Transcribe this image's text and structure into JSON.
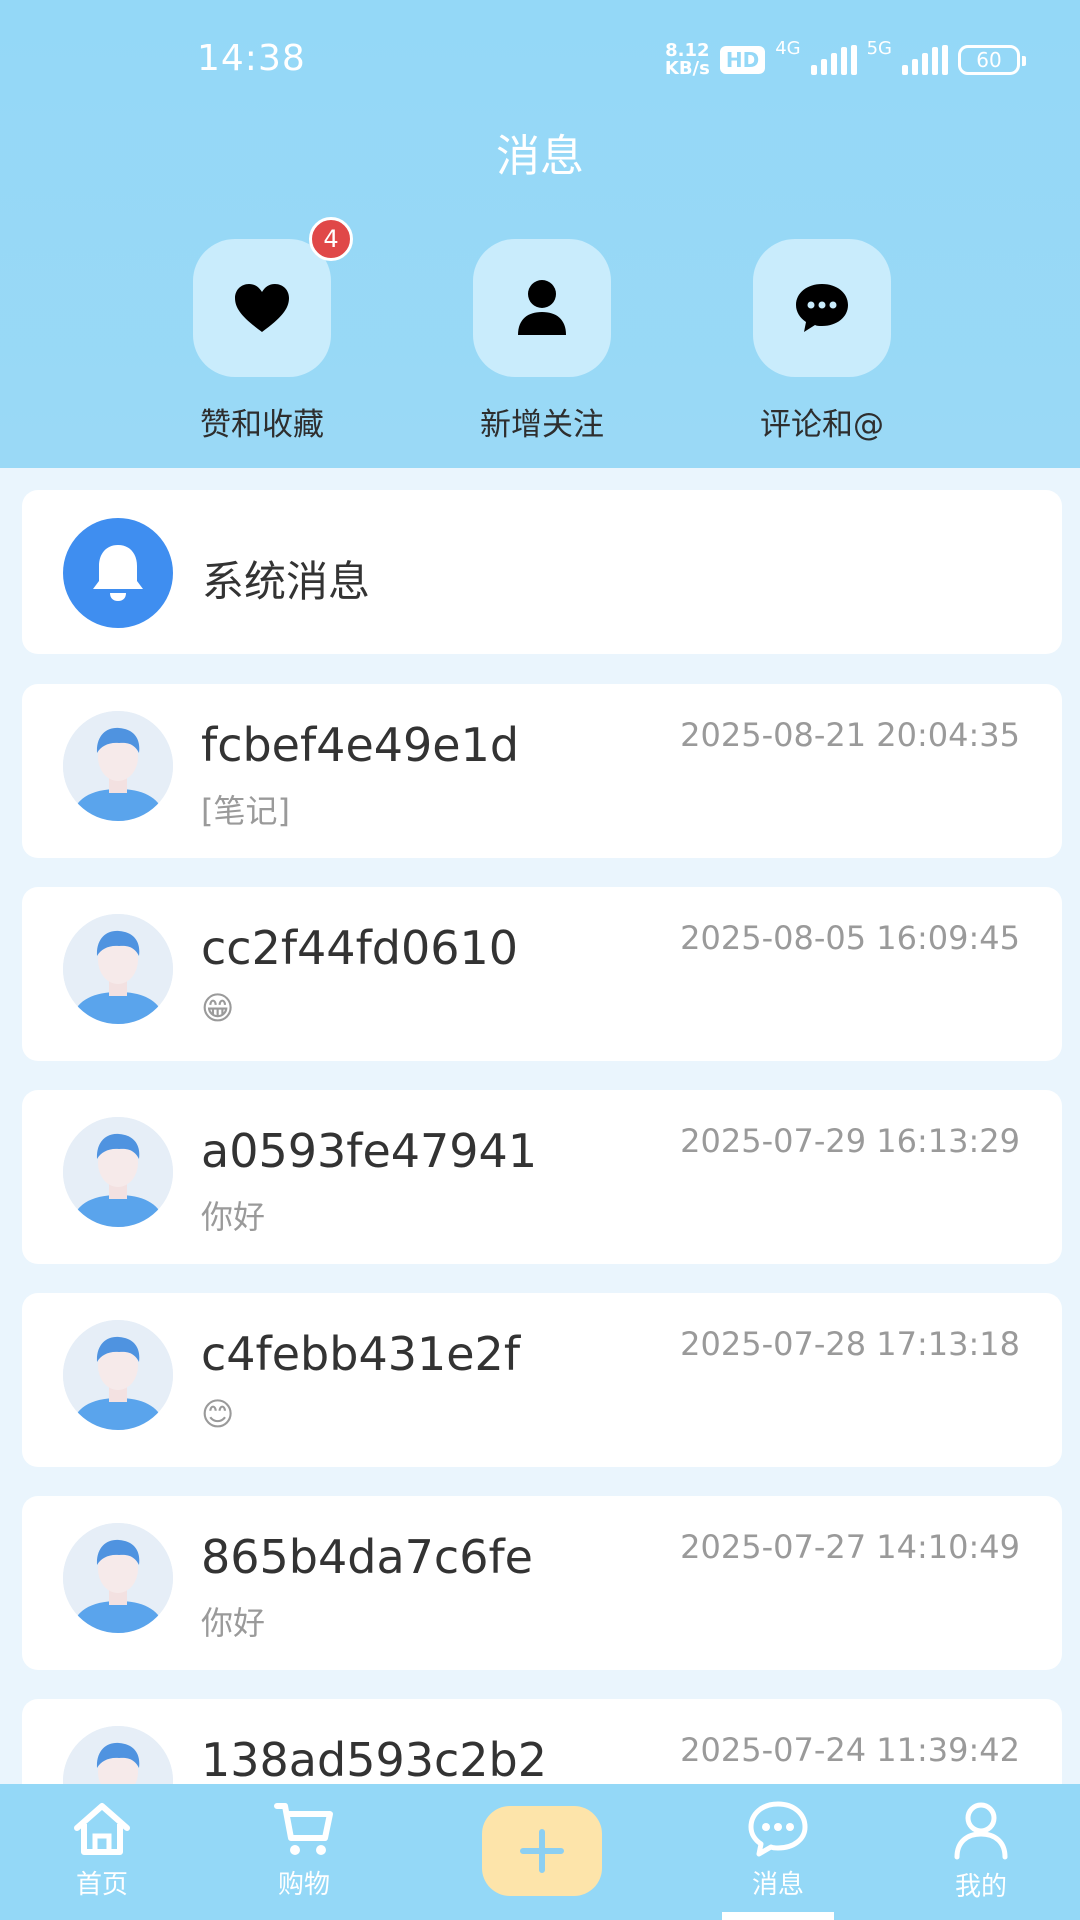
{
  "status_bar": {
    "time": "14:38",
    "speed_value": "8.12",
    "speed_unit": "KB/s",
    "hd": "HD",
    "network1": "4G",
    "network2": "5G",
    "battery": "60"
  },
  "header": {
    "title": "消息"
  },
  "quick_actions": [
    {
      "label": "赞和收藏",
      "icon": "heart-icon",
      "badge": "4"
    },
    {
      "label": "新增关注",
      "icon": "person-icon"
    },
    {
      "label": "评论和@",
      "icon": "chat-bubble-icon"
    }
  ],
  "system_message": {
    "title": "系统消息",
    "icon": "bell-icon"
  },
  "conversations": [
    {
      "name": "fcbef4e49e1d",
      "time": "2025-08-21 20:04:35",
      "preview": "[笔记]"
    },
    {
      "name": "cc2f44fd0610",
      "time": "2025-08-05 16:09:45",
      "preview": "😁"
    },
    {
      "name": "a0593fe47941",
      "time": "2025-07-29 16:13:29",
      "preview": "你好"
    },
    {
      "name": "c4febb431e2f",
      "time": "2025-07-28 17:13:18",
      "preview": "😊"
    },
    {
      "name": "865b4da7c6fe",
      "time": "2025-07-27 14:10:49",
      "preview": "你好"
    },
    {
      "name": "138ad593c2b2",
      "time": "2025-07-24 11:39:42",
      "preview": ""
    }
  ],
  "bottom_nav": {
    "items": [
      {
        "label": "首页",
        "icon": "home-icon"
      },
      {
        "label": "购物",
        "icon": "cart-icon"
      },
      {
        "label": "",
        "icon": "plus-icon"
      },
      {
        "label": "消息",
        "icon": "chat-icon",
        "active": true
      },
      {
        "label": "我的",
        "icon": "user-icon"
      }
    ]
  },
  "colors": {
    "header_bg": "#94d8f7",
    "page_bg": "#eaf5fd",
    "badge": "#e04848",
    "system_icon": "#3f8ef0",
    "plus_button": "#fde4aa"
  }
}
